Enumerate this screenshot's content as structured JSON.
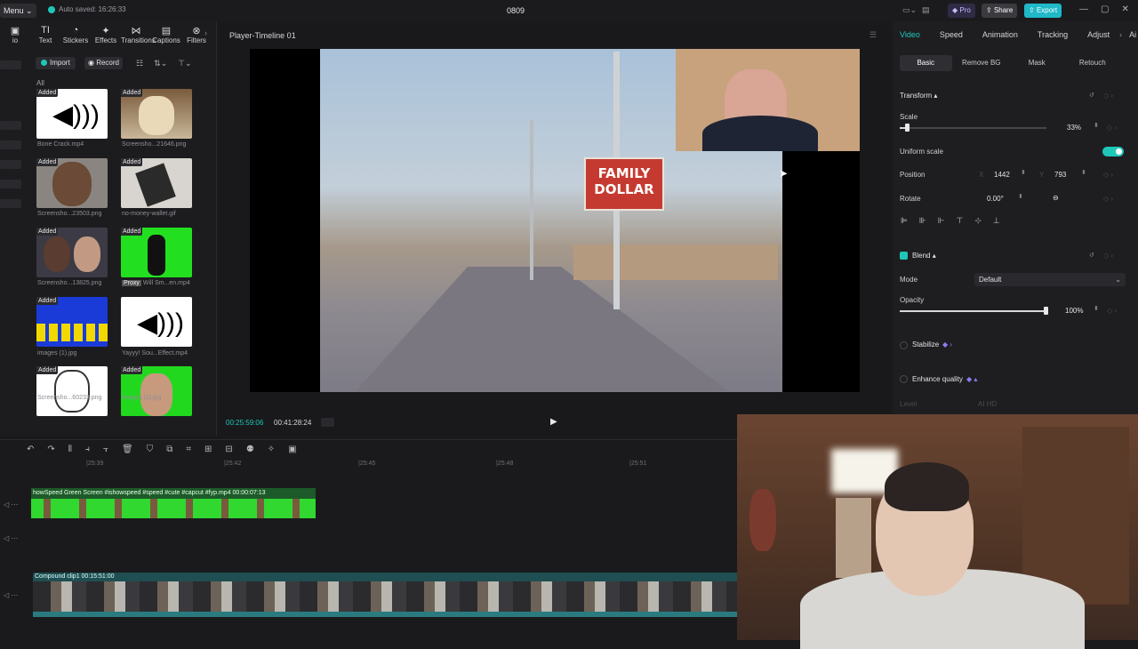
{
  "app": {
    "menu_label": "Menu",
    "autosave": "Auto saved: 16:26:33",
    "title": "0809",
    "pro_label": "Pro",
    "share_label": "Share",
    "export_label": "Export"
  },
  "toolbar": {
    "tools": [
      {
        "label": "io",
        "icon": "media-icon"
      },
      {
        "label": "Text",
        "icon": "text-icon"
      },
      {
        "label": "Stickers",
        "icon": "sticker-icon"
      },
      {
        "label": "Effects",
        "icon": "effects-icon"
      },
      {
        "label": "Transitions",
        "icon": "transition-icon"
      },
      {
        "label": "Captions",
        "icon": "captions-icon"
      },
      {
        "label": "Filters",
        "icon": "filters-icon"
      }
    ]
  },
  "media": {
    "import_label": "Import",
    "record_label": "Record",
    "filter_label": "All",
    "added_badge": "Added",
    "items": [
      {
        "name": "Bone Crack.mp4",
        "kind": "speaker-icon"
      },
      {
        "name": "Screensho...21646.png",
        "kind": "face"
      },
      {
        "name": "Screensho...23503.png",
        "kind": "face"
      },
      {
        "name": "no-money-wallet.gif",
        "kind": "hands"
      },
      {
        "name": "Screensho...13825.png",
        "kind": "people"
      },
      {
        "name": "Will Sm...en.mp4",
        "kind": "greenscreen",
        "tag": "Proxy"
      },
      {
        "name": "images (1).jpg",
        "kind": "meme"
      },
      {
        "name": "Yayyy! Sou...Effect.mp4",
        "kind": "speaker-icon"
      },
      {
        "name": "Screensho...60233.png",
        "kind": "rageface"
      },
      {
        "name": "images (2).jpg",
        "kind": "greenscreen"
      }
    ]
  },
  "player": {
    "title": "Player-Timeline 01",
    "current_time": "00:25:59:06",
    "total_time": "00:41:28:24",
    "sign_text": "FAMILY DOLLAR"
  },
  "inspector": {
    "tabs": [
      "Video",
      "Speed",
      "Animation",
      "Tracking",
      "Adjust",
      "Ai"
    ],
    "subtabs": [
      "Basic",
      "Remove BG",
      "Mask",
      "Retouch"
    ],
    "transform_label": "Transform",
    "scale_label": "Scale",
    "scale_value": "33%",
    "scale_fraction": 0.05,
    "uniform_scale_label": "Uniform scale",
    "position_label": "Position",
    "pos_x_label": "X",
    "pos_x": "1442",
    "pos_y_label": "Y",
    "pos_y": "793",
    "rotate_label": "Rotate",
    "rotate_value": "0.00°",
    "blend_label": "Blend",
    "mode_label": "Mode",
    "mode_value": "Default",
    "opacity_label": "Opacity",
    "opacity_value": "100%",
    "opacity_fraction": 1.0,
    "stabilize_label": "Stabilize",
    "enhance_label": "Enhance quality",
    "level_label": "Level",
    "level_value": "AI HD"
  },
  "timeline": {
    "ticks": [
      "|25:39",
      "|25:42",
      "|25:45",
      "|25:48",
      "|25:51"
    ],
    "green_clip_label": "howSpeed   Green Screen #ishowspeed #speed #cute #capcut #fyp.mp4   00:00:07:13",
    "compound_clip_label": "Compound clip1   00:15:51:00"
  },
  "colors": {
    "accent": "#1fc7b8",
    "green_screen": "#2bd32b",
    "sign_red": "#c53a30"
  }
}
